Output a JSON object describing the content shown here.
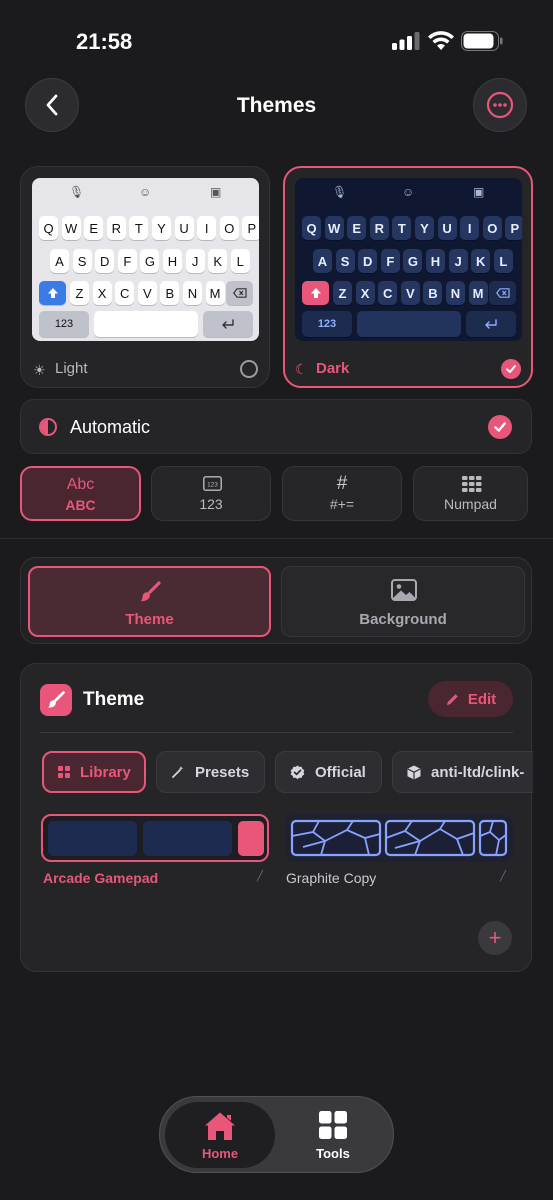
{
  "status_bar": {
    "time": "21:58"
  },
  "header": {
    "title": "Themes"
  },
  "theme_cards": {
    "light": {
      "label": "Light",
      "selected": false
    },
    "dark": {
      "label": "Dark",
      "selected": true
    }
  },
  "keyboard_preview": {
    "row1": [
      "Q",
      "W",
      "E",
      "R",
      "T",
      "Y",
      "U",
      "I",
      "O",
      "P"
    ],
    "row2": [
      "A",
      "S",
      "D",
      "F",
      "G",
      "H",
      "J",
      "K",
      "L"
    ],
    "row3": [
      "Z",
      "X",
      "C",
      "V",
      "B",
      "N",
      "M"
    ],
    "numbers_key": "123"
  },
  "automatic": {
    "label": "Automatic",
    "checked": true
  },
  "layout_tabs": [
    {
      "top": "Abc",
      "bottom": "ABC",
      "active": true
    },
    {
      "top": "",
      "bottom": "123",
      "active": false
    },
    {
      "top": "#",
      "bottom": "#+=",
      "active": false
    },
    {
      "top": "",
      "bottom": "Numpad",
      "active": false
    }
  ],
  "segment": {
    "theme": "Theme",
    "background": "Background"
  },
  "panel": {
    "title": "Theme",
    "edit_label": "Edit",
    "chips": [
      "Library",
      "Presets",
      "Official",
      "anti-ltd/clink-"
    ],
    "presets": [
      {
        "name": "Arcade Gamepad",
        "selected": true
      },
      {
        "name": "Graphite Copy",
        "selected": false
      }
    ],
    "add_label": "+"
  },
  "nav": {
    "home": "Home",
    "tools": "Tools"
  },
  "colors": {
    "accent": "#e8577a",
    "background": "#1b1b1e",
    "card": "#252528"
  }
}
